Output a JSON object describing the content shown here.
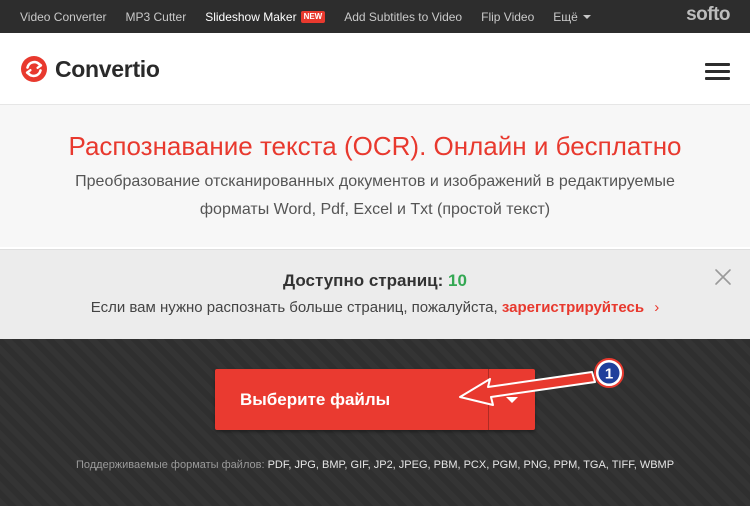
{
  "topbar": {
    "nav": [
      {
        "label": "Video Converter"
      },
      {
        "label": "MP3 Cutter"
      },
      {
        "label": "Slideshow Maker",
        "badge": "NEW"
      },
      {
        "label": "Add Subtitles to Video"
      },
      {
        "label": "Flip Video"
      },
      {
        "label": "Ещё"
      }
    ],
    "brand": "softo"
  },
  "header": {
    "logo_text": "Convertio"
  },
  "hero": {
    "title": "Распознавание текста (OCR). Онлайн и бесплатно",
    "subtitle_line1": "Преобразование отсканированных документов и изображений в редактируемые",
    "subtitle_line2": "форматы Word, Pdf, Excel и Txt (простой текст)"
  },
  "notice": {
    "pages_label": "Доступно страниц:",
    "pages_count": "10",
    "message": "Если вам нужно распознать больше страниц, пожалуйста,",
    "register_link": "зарегистрируйтесь",
    "register_chevron": "›"
  },
  "upload": {
    "button_label": "Выберите файлы",
    "formats_label": "Поддерживаемые форматы файлов:",
    "formats_list": "PDF, JPG, BMP, GIF, JP2, JPEG, PBM, PCX, PGM, PNG, PPM, TGA, TIFF, WBMP"
  },
  "annotation": {
    "marker": "1"
  },
  "colors": {
    "accent": "#e8392e",
    "count": "#34a853",
    "dark": "#2f2f2f"
  }
}
